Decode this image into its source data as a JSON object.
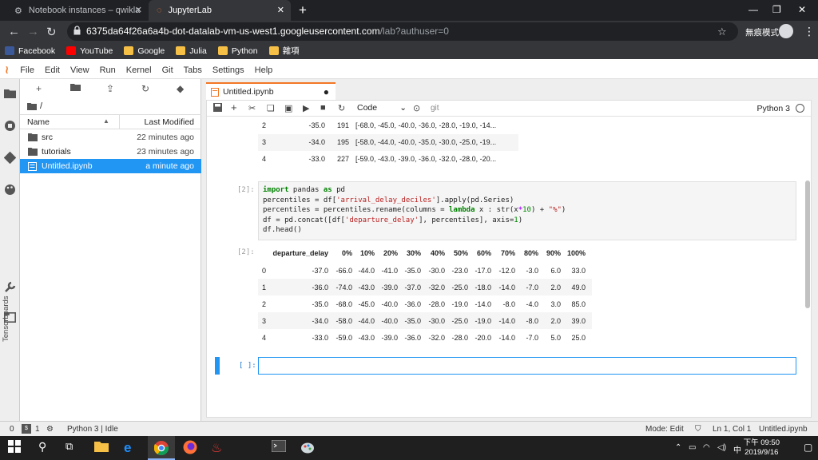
{
  "browser": {
    "tabs": [
      {
        "title": "Notebook instances – qwiklabs",
        "active": false
      },
      {
        "title": "JupyterLab",
        "active": true
      }
    ],
    "url_host": "6375da64f26a6a4b-dot-datalab-vm-us-west1.googleusercontent.com",
    "url_path": "/lab?authuser=0",
    "incognito_label": "無痕模式",
    "bookmarks": [
      {
        "label": "Facebook",
        "icon": "facebook-icon",
        "color": "#3b5998"
      },
      {
        "label": "YouTube",
        "icon": "youtube-icon",
        "color": "#ff0000"
      },
      {
        "label": "Google",
        "icon": "folder-icon",
        "color": "#f6c046"
      },
      {
        "label": "Julia",
        "icon": "folder-icon",
        "color": "#f6c046"
      },
      {
        "label": "Python",
        "icon": "folder-icon",
        "color": "#f6c046"
      },
      {
        "label": "雜項",
        "icon": "folder-icon",
        "color": "#f6c046"
      }
    ]
  },
  "jupyter": {
    "menu": [
      "File",
      "Edit",
      "View",
      "Run",
      "Kernel",
      "Git",
      "Tabs",
      "Settings",
      "Help"
    ],
    "sidebar_label": "Tensorboards",
    "filebrowser": {
      "breadcrumb": "/",
      "col_name": "Name",
      "col_modified": "Last Modified",
      "files": [
        {
          "name": "src",
          "modified": "22 minutes ago",
          "type": "folder",
          "selected": false
        },
        {
          "name": "tutorials",
          "modified": "23 minutes ago",
          "type": "folder",
          "selected": false
        },
        {
          "name": "Untitled.ipynb",
          "modified": "a minute ago",
          "type": "notebook",
          "selected": true
        }
      ]
    },
    "doc_tab": "Untitled.ipynb",
    "cell_type": "Code",
    "git_label": "git",
    "kernel": "Python 3",
    "prev_output": [
      {
        "idx": "2",
        "delay": "-35.0",
        "count": "191",
        "list": "[-68.0, -45.0, -40.0, -36.0, -28.0, -19.0, -14..."
      },
      {
        "idx": "3",
        "delay": "-34.0",
        "count": "195",
        "list": "[-58.0, -44.0, -40.0, -35.0, -30.0, -25.0, -19..."
      },
      {
        "idx": "4",
        "delay": "-33.0",
        "count": "227",
        "list": "[-59.0, -43.0, -39.0, -36.0, -32.0, -28.0, -20..."
      }
    ],
    "cell2": {
      "prompt_in": "[2]:",
      "prompt_out": "[2]:",
      "code": [
        "import pandas as pd",
        "percentiles = df['arrival_delay_deciles'].apply(pd.Series)",
        "percentiles = percentiles.rename(columns = lambda x : str(x*10) + \"%\")",
        "df = pd.concat([df['departure_delay'], percentiles], axis=1)",
        "df.head()"
      ],
      "table": {
        "columns": [
          "departure_delay",
          "0%",
          "10%",
          "20%",
          "30%",
          "40%",
          "50%",
          "60%",
          "70%",
          "80%",
          "90%",
          "100%"
        ],
        "rows": [
          {
            "idx": "0",
            "cells": [
              "-37.0",
              "-66.0",
              "-44.0",
              "-41.0",
              "-35.0",
              "-30.0",
              "-23.0",
              "-17.0",
              "-12.0",
              "-3.0",
              "6.0",
              "33.0"
            ]
          },
          {
            "idx": "1",
            "cells": [
              "-36.0",
              "-74.0",
              "-43.0",
              "-39.0",
              "-37.0",
              "-32.0",
              "-25.0",
              "-18.0",
              "-14.0",
              "-7.0",
              "2.0",
              "49.0"
            ]
          },
          {
            "idx": "2",
            "cells": [
              "-35.0",
              "-68.0",
              "-45.0",
              "-40.0",
              "-36.0",
              "-28.0",
              "-19.0",
              "-14.0",
              "-8.0",
              "-4.0",
              "3.0",
              "85.0"
            ]
          },
          {
            "idx": "3",
            "cells": [
              "-34.0",
              "-58.0",
              "-44.0",
              "-40.0",
              "-35.0",
              "-30.0",
              "-25.0",
              "-19.0",
              "-14.0",
              "-8.0",
              "2.0",
              "39.0"
            ]
          },
          {
            "idx": "4",
            "cells": [
              "-33.0",
              "-59.0",
              "-43.0",
              "-39.0",
              "-36.0",
              "-32.0",
              "-28.0",
              "-20.0",
              "-14.0",
              "-7.0",
              "5.0",
              "25.0"
            ]
          }
        ]
      }
    },
    "active_prompt": "[ ]:",
    "status": {
      "count1": "0",
      "count2": "1",
      "kernel_status": "Python 3 | Idle",
      "mode": "Mode: Edit",
      "position": "Ln 1, Col 1",
      "file": "Untitled.ipynb"
    }
  },
  "taskbar": {
    "time": "下午 09:50",
    "date": "2019/9/16",
    "ime": "中"
  }
}
